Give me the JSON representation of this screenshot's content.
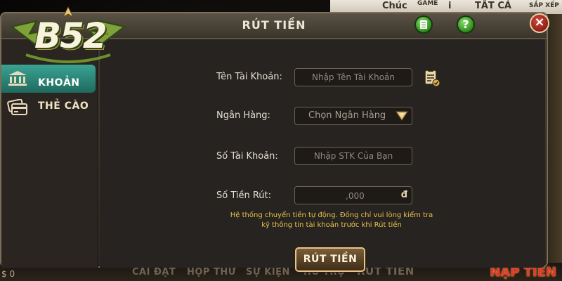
{
  "background": {
    "top_items": [
      "Chúc",
      "GAME",
      "i",
      "TẤT CẢ",
      "SẮP XẾP"
    ],
    "bottom_items": [
      "CÀI ĐẶT",
      "HỘP THƯ",
      "SỰ KIỆN",
      "HỖ TRỢ",
      "RÚT TIỀN"
    ],
    "deposit_label": "NẠP TIỀN",
    "balance": "$ 0"
  },
  "logo": {
    "text": "B52"
  },
  "modal": {
    "title": "RÚT TIỀN",
    "help_symbol": "?",
    "close_symbol": "×"
  },
  "sidebar": {
    "items": [
      {
        "label": "KHOẢN",
        "icon": "bank-icon",
        "active": true
      },
      {
        "label": "THẺ CÀO",
        "icon": "card-icon",
        "active": false
      }
    ]
  },
  "form": {
    "account_name": {
      "label": "Tên Tài Khoản:",
      "placeholder": "Nhập Tên Tài Khoản"
    },
    "bank": {
      "label": "Ngân Hàng:",
      "selected": "Chọn Ngân Hàng"
    },
    "account_number": {
      "label": "Số Tài Khoản:",
      "placeholder": "Nhập STK Của Bạn"
    },
    "amount": {
      "label": "Số Tiền Rút:",
      "value": ",000",
      "currency": "đ"
    },
    "notice_line1": "Hệ thống chuyển tiền tự động. Đồng chí vui lòng kiểm tra",
    "notice_line2": "kỹ thông tin tài khoản trước khi Rút tiền",
    "submit_label": "RÚT TIỀN"
  },
  "colors": {
    "accent_gold": "#e8c487",
    "notice_yellow": "#e9c24a",
    "active_tab": "#3aa392",
    "close_red": "#c0392b"
  }
}
